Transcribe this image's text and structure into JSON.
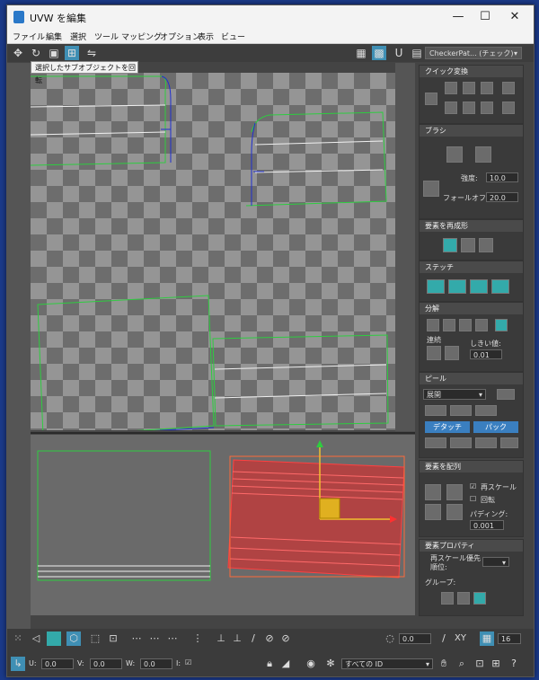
{
  "window": {
    "title": "UVW を編集"
  },
  "menu": [
    "ファイル",
    "編集",
    "選択",
    "ツール",
    "マッピング",
    "オプション",
    "表示",
    "ビュー"
  ],
  "toolbar": {
    "uv_label": "U V",
    "checker_dropdown": "CheckerPat... (チェック)"
  },
  "tooltip": "選択したサブオブジェクトを回転",
  "panel": {
    "quick_transform": "クイック変換",
    "brush": {
      "title": "ブラシ",
      "strength_label": "強度:",
      "strength_value": "10.0",
      "falloff_label": "フォールオフ:",
      "falloff_value": "20.0"
    },
    "reshape": "要素を再成形",
    "stitch": "ステッチ",
    "explode": {
      "title": "分解",
      "link_label": "連続",
      "threshold_label": "しきい値:",
      "threshold_value": "0.01"
    },
    "peel": {
      "title": "ピール",
      "mode_value": "展開",
      "detach_label": "デタッチ",
      "pack_label": "パック"
    },
    "arrange": {
      "title": "要素を配列",
      "rescale_label": "再スケール",
      "rotate_label": "回転",
      "padding_label": "パディング:",
      "padding_value": "0.001"
    },
    "props": {
      "title": "要素プロパティ",
      "rescale_priority_label": "再スケール優先順位:",
      "group_label": "グループ:"
    }
  },
  "status": {
    "angle_value": "0.0",
    "xy_label": "XY",
    "grid_value": "16",
    "u_label": "U:",
    "u_value": "0.0",
    "v_label": "V:",
    "v_value": "0.0",
    "w_label": "W:",
    "w_value": "0.0",
    "i_label": "I:",
    "id_dropdown": "すべての ID"
  },
  "colors": {
    "accent": "#3f8fb4",
    "selection": "#d93a3a",
    "uv_edge": "#2ecc40"
  }
}
